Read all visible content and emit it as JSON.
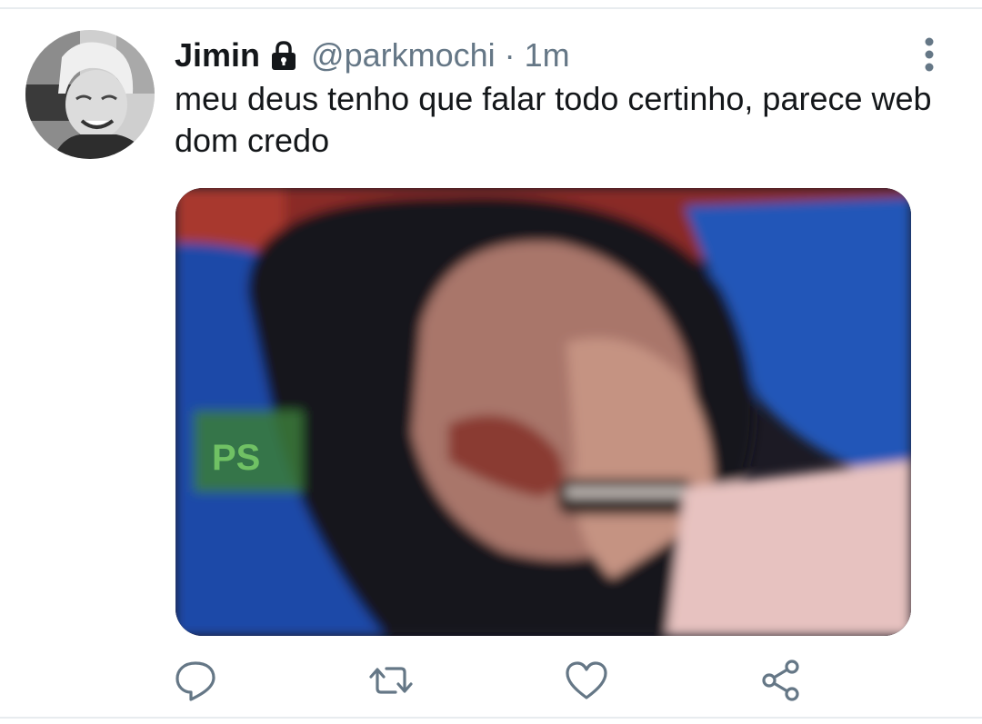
{
  "tweet": {
    "author": {
      "display_name": "Jimin",
      "protected_icon": "lock-icon",
      "handle": "@parkmochi"
    },
    "separator": "·",
    "time": "1m",
    "text": "meu deus tenho que falar todo certinho, parece web dom credo",
    "media": {
      "watermark_text": "PS"
    }
  },
  "actions": [
    {
      "icon": "reply-icon"
    },
    {
      "icon": "retweet-icon"
    },
    {
      "icon": "like-icon"
    },
    {
      "icon": "share-icon"
    }
  ],
  "menu_icon": "more-vertical-icon",
  "colors": {
    "primary_text": "#14171a",
    "secondary_text": "#657786",
    "divider": "#e8ecef"
  }
}
